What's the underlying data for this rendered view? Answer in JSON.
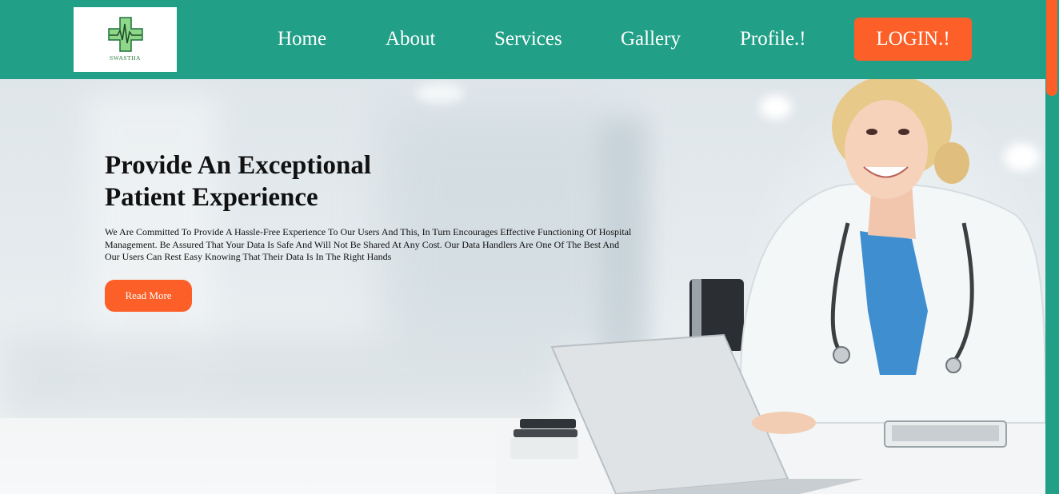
{
  "logo": {
    "brand": "SWASTHA",
    "icon": "medical-cross-heartbeat-icon",
    "cross_color": "#8fd88a",
    "line_color": "#1f6e3a"
  },
  "nav": {
    "items": [
      "Home",
      "About",
      "Services",
      "Gallery",
      "Profile.!"
    ],
    "login_label": "LOGIN.!"
  },
  "hero": {
    "title_line1": "Provide An Exceptional",
    "title_line2": "Patient Experience",
    "description": "We Are Committed To Provide A Hassle-Free Experience To Our Users And This, In Turn Encourages Effective Functioning Of Hospital Management. Be Assured That Your Data Is Safe And Will Not Be Shared At Any Cost. Our Data Handlers Are One Of The Best And Our Users Can Rest Easy Knowing That Their Data Is In The Right Hands",
    "button_label": "Read More"
  },
  "colors": {
    "header": "#21a087",
    "accent": "#fc5f28",
    "text": "#111111"
  }
}
